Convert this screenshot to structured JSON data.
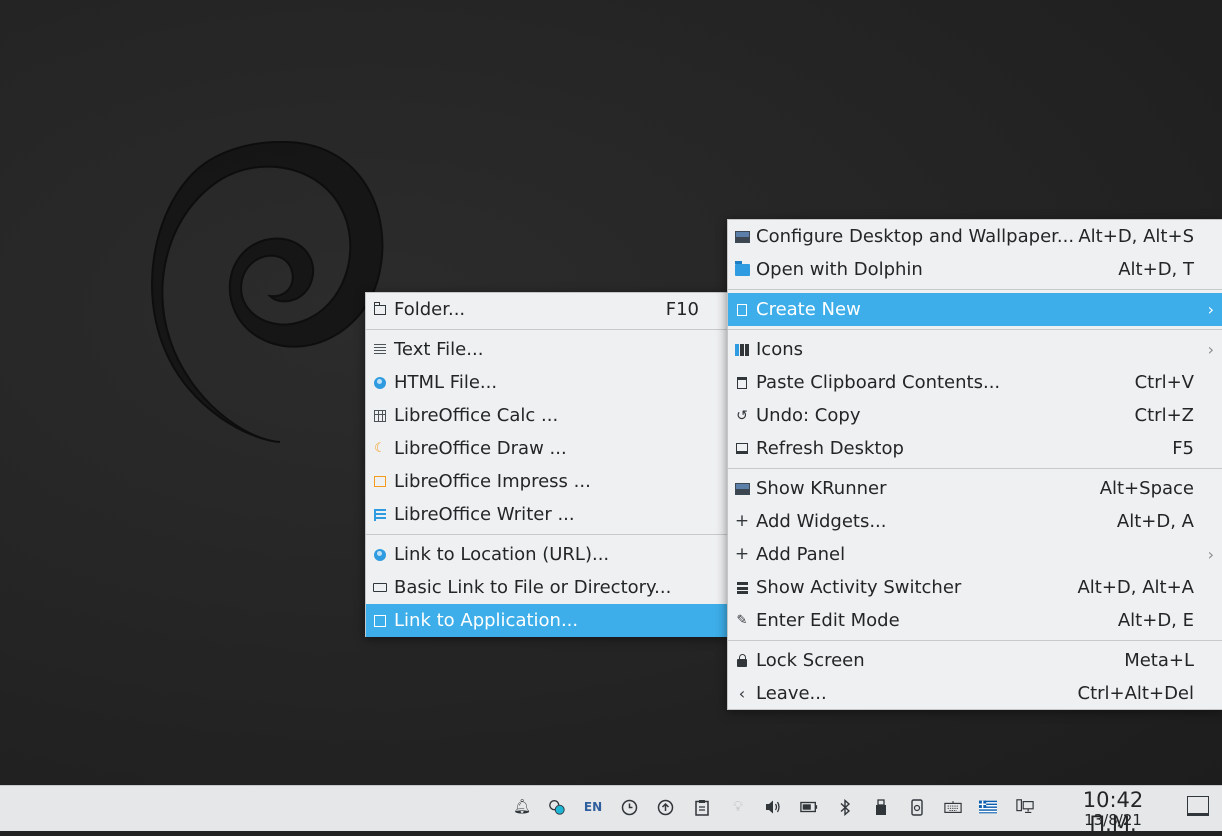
{
  "desktop_menu": {
    "items": [
      {
        "label": "Configure Desktop and Wallpaper...",
        "shortcut": "Alt+D, Alt+S",
        "icon": "wallpaper-icon"
      },
      {
        "label": "Open with Dolphin",
        "shortcut": "Alt+D, T",
        "icon": "folder-icon"
      },
      {
        "label": "Create New",
        "shortcut": "",
        "icon": "new-document-icon",
        "highlighted": true,
        "submenu": true
      },
      {
        "label": "Icons",
        "shortcut": "",
        "icon": "icons-view-icon",
        "submenu": true
      },
      {
        "label": "Paste Clipboard Contents...",
        "shortcut": "Ctrl+V",
        "icon": "clipboard-icon"
      },
      {
        "label": "Undo: Copy",
        "shortcut": "Ctrl+Z",
        "icon": "undo-icon"
      },
      {
        "label": "Refresh Desktop",
        "shortcut": "F5",
        "icon": "refresh-icon"
      },
      {
        "label": "Show KRunner",
        "shortcut": "Alt+Space",
        "icon": "krunner-icon"
      },
      {
        "label": "Add Widgets...",
        "shortcut": "Alt+D, A",
        "icon": "plus-icon"
      },
      {
        "label": "Add Panel",
        "shortcut": "",
        "icon": "plus-icon",
        "submenu": true
      },
      {
        "label": "Show Activity Switcher",
        "shortcut": "Alt+D, Alt+A",
        "icon": "activity-switcher-icon"
      },
      {
        "label": "Enter Edit Mode",
        "shortcut": "Alt+D, E",
        "icon": "pencil-icon"
      },
      {
        "label": "Lock Screen",
        "shortcut": "Meta+L",
        "icon": "lock-icon"
      },
      {
        "label": "Leave...",
        "shortcut": "Ctrl+Alt+Del",
        "icon": "leave-icon"
      }
    ]
  },
  "create_new_menu": {
    "items": [
      {
        "label": "Folder...",
        "shortcut": "F10",
        "icon": "folder-icon"
      },
      {
        "label": "Text File...",
        "icon": "text-file-icon"
      },
      {
        "label": "HTML File...",
        "icon": "globe-icon"
      },
      {
        "label": "LibreOffice Calc  ...",
        "icon": "calc-icon"
      },
      {
        "label": "LibreOffice Draw  ...",
        "icon": "draw-icon"
      },
      {
        "label": "LibreOffice Impress  ...",
        "icon": "impress-icon"
      },
      {
        "label": "LibreOffice Writer  ...",
        "icon": "writer-icon"
      },
      {
        "label": "Link to Location (URL)...",
        "icon": "globe-icon"
      },
      {
        "label": "Basic Link to File or Directory...",
        "icon": "link-icon"
      },
      {
        "label": "Link to Application...",
        "icon": "application-icon",
        "highlighted": true
      }
    ]
  },
  "taskbar": {
    "keyboard_layout": "EN",
    "clock_time": "10:42 Π.Μ.",
    "clock_date": "13/8/21"
  },
  "colors": {
    "highlight": "#3daee9",
    "menu_bg": "#eff0f1",
    "panel_bg": "#e6e7e8"
  }
}
